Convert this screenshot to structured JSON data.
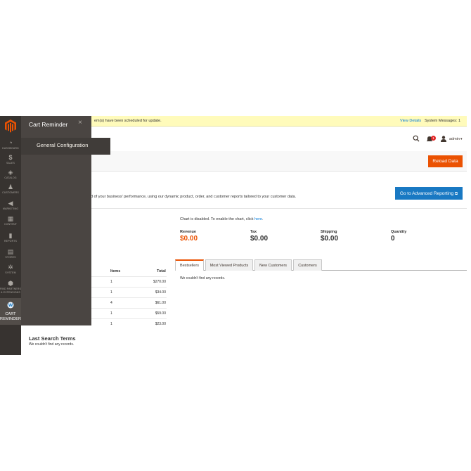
{
  "notice": {
    "message": "em(s) have been scheduled for update.",
    "view_details": "View Details",
    "system_messages": "System Messages: 1"
  },
  "nav": {
    "items": [
      {
        "label": "DASHBOARD",
        "icon": "speedometer-icon"
      },
      {
        "label": "SALES",
        "icon": "dollar-icon"
      },
      {
        "label": "CATALOG",
        "icon": "cube-icon"
      },
      {
        "label": "CUSTOMERS",
        "icon": "person-icon"
      },
      {
        "label": "MARKETING",
        "icon": "megaphone-icon"
      },
      {
        "label": "CONTENT",
        "icon": "layout-icon"
      },
      {
        "label": "REPORTS",
        "icon": "bar-chart-icon"
      },
      {
        "label": "STORES",
        "icon": "storefront-icon"
      },
      {
        "label": "SYSTEM",
        "icon": "gear-icon"
      },
      {
        "label": "FIND PARTNERS",
        "label2": "& EXTENSIONS",
        "icon": "puzzle-icon"
      }
    ],
    "cart": {
      "label1": "CART",
      "label2": "REMINDER",
      "icon": "cart-reminder-logo-icon"
    }
  },
  "flyout": {
    "title": "Cart Reminder",
    "close": "×",
    "item": "General Configuration"
  },
  "header": {
    "user": "admin",
    "notifications_count": "1",
    "caret": "▾"
  },
  "actions": {
    "reload": "Reload Data",
    "advanced": "Go to Advanced Reporting"
  },
  "intro_text": "d of your business' performance, using our dynamic product, order, and customer reports tailored to your customer data.",
  "chart": {
    "disabled_text": "Chart is disabled. To enable the chart, click ",
    "link": "here",
    "after": "."
  },
  "stats": [
    {
      "label": "Revenue",
      "value": "$0.00"
    },
    {
      "label": "Tax",
      "value": "$0.00"
    },
    {
      "label": "Shipping",
      "value": "$0.00"
    },
    {
      "label": "Quantity",
      "value": "0"
    }
  ],
  "tabs": [
    "Bestsellers",
    "Most Viewed Products",
    "New Customers",
    "Customers"
  ],
  "tab_empty": "We couldn't find any records.",
  "orders_table": {
    "headers": [
      "Items",
      "Total"
    ],
    "rows": [
      {
        "items": "1",
        "total": "$270.00"
      },
      {
        "items": "1",
        "total": "$34.00"
      },
      {
        "items": "4",
        "total": "$61.00"
      },
      {
        "items": "1",
        "total": "$59.00"
      },
      {
        "items": "1",
        "total": "$23.00"
      }
    ]
  },
  "last_search": {
    "title": "Last Search Terms",
    "empty": "We couldn't find any records."
  }
}
